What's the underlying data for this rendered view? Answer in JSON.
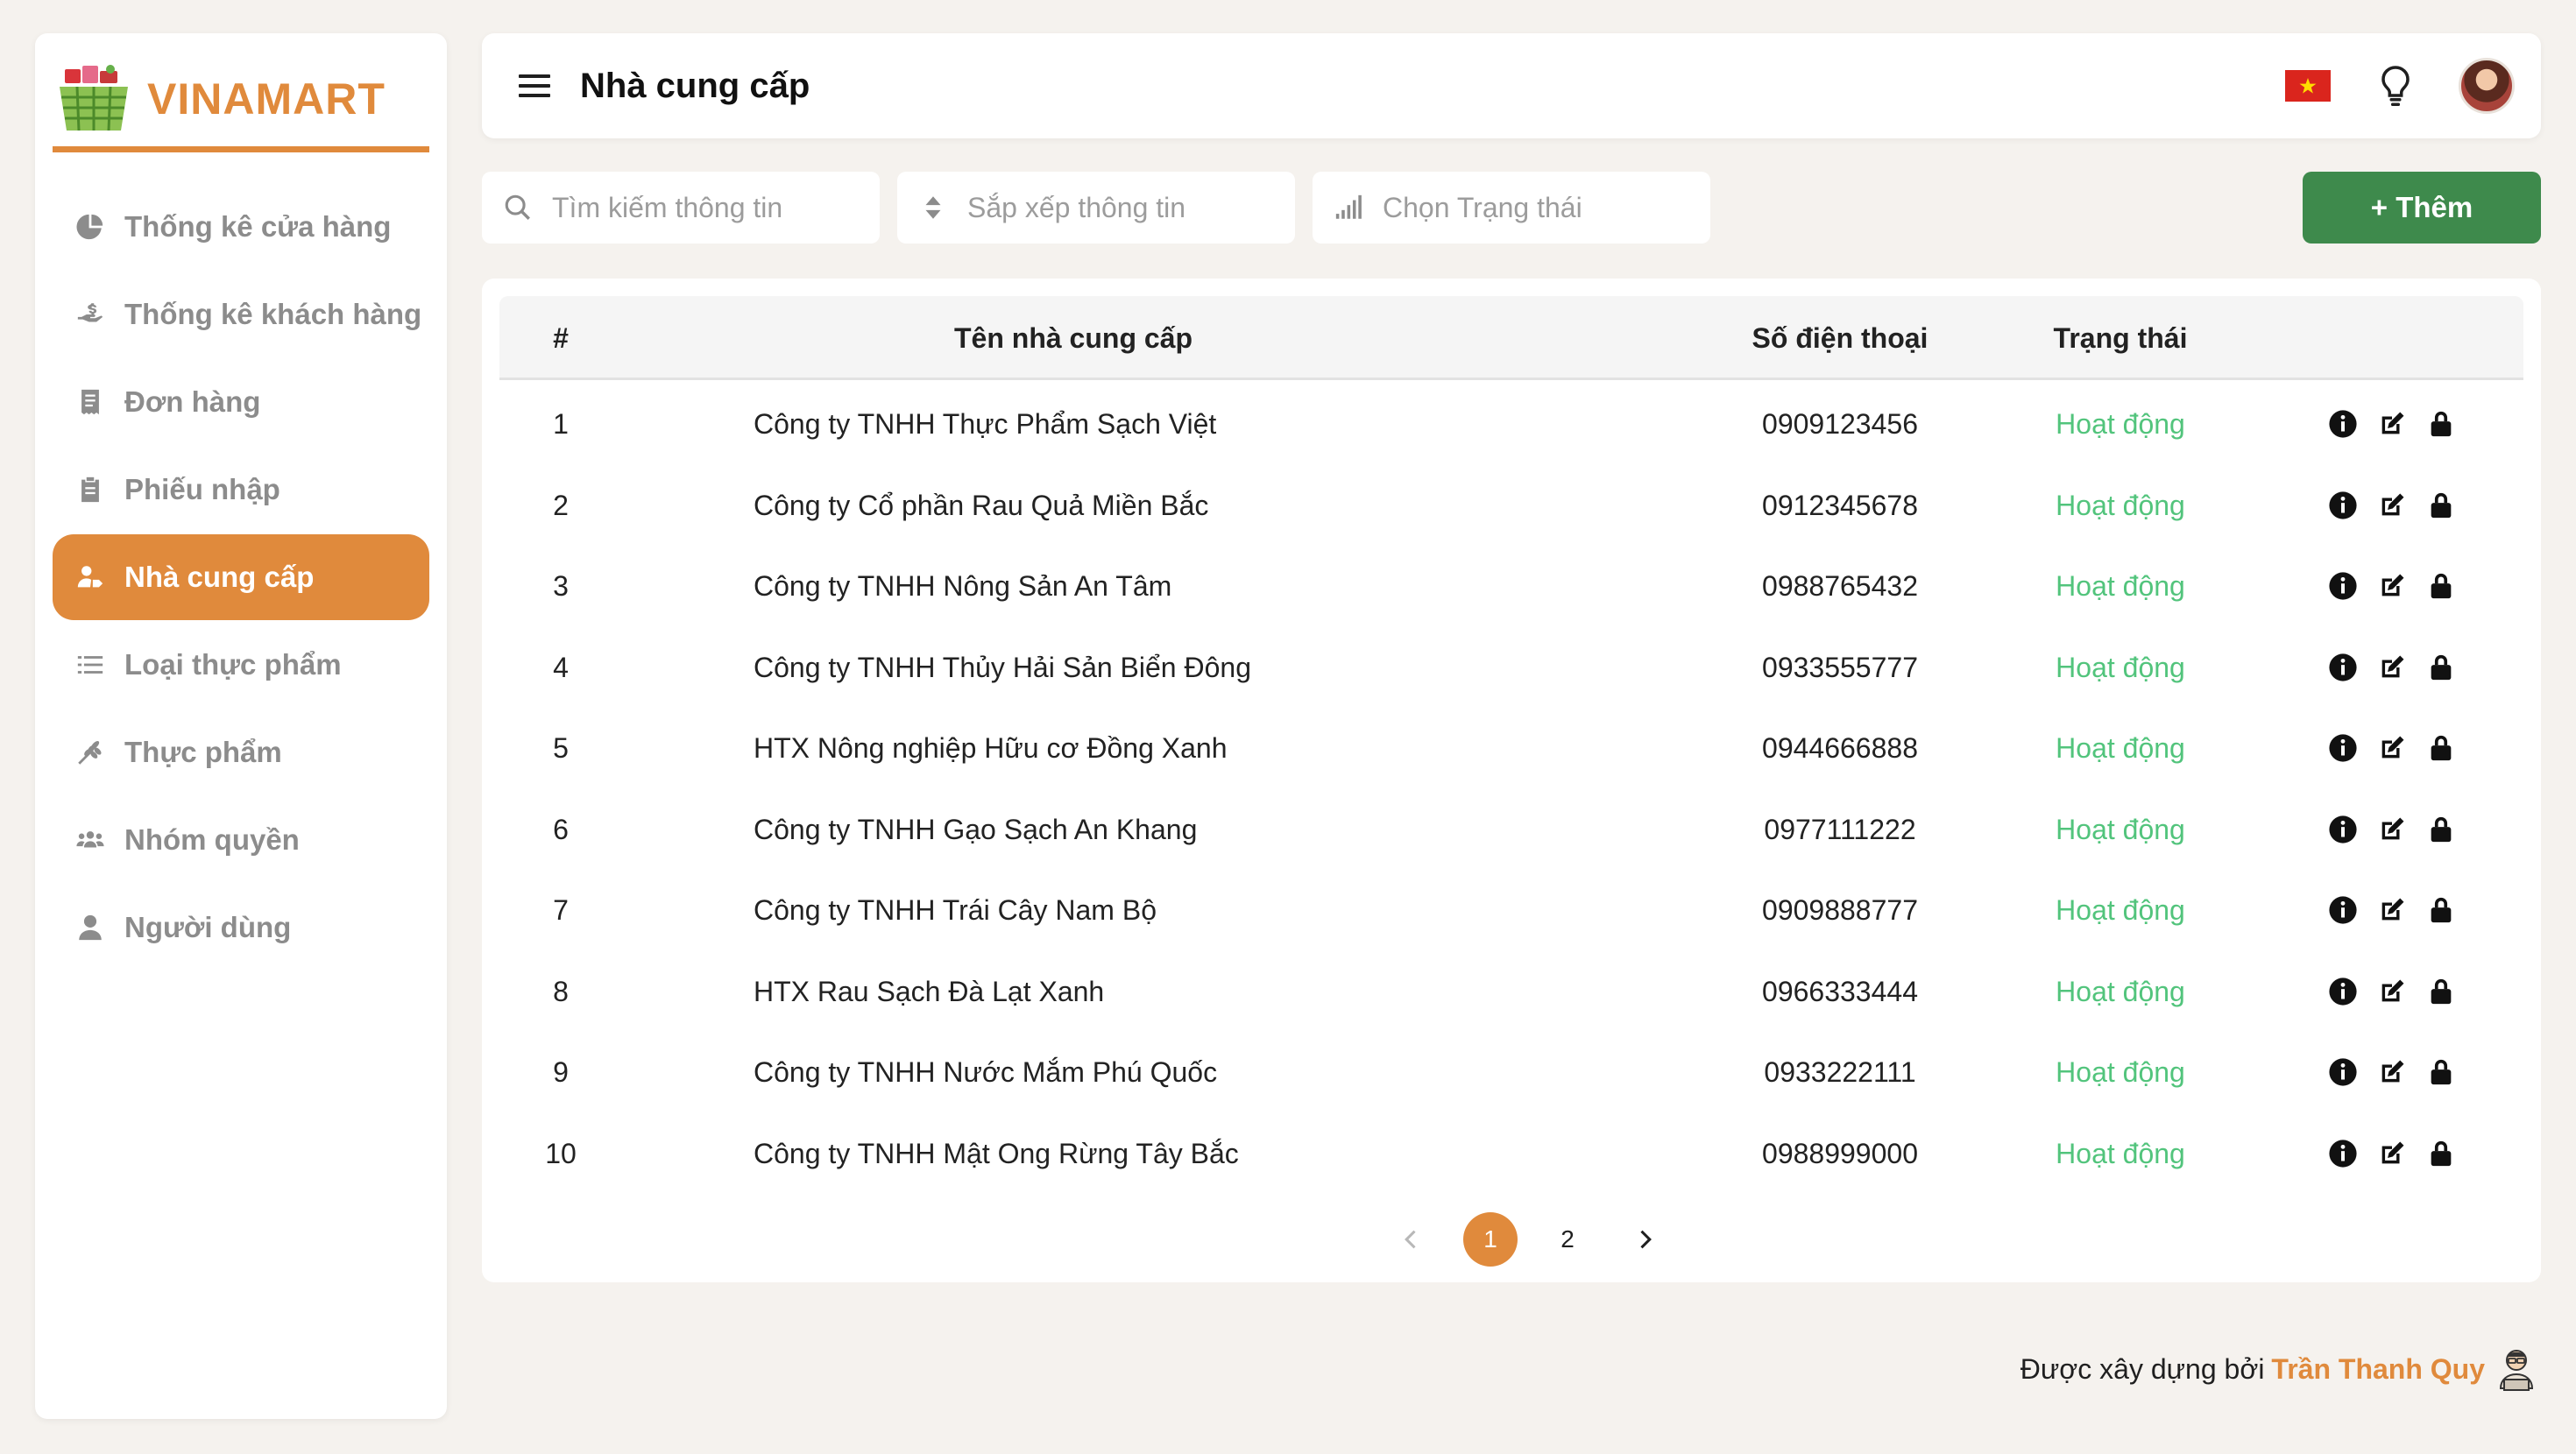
{
  "brand": {
    "name": "VINAMART"
  },
  "sidebar": {
    "items": [
      {
        "label": "Thống kê cửa hàng",
        "icon": "pie-chart-icon",
        "active": false
      },
      {
        "label": "Thống kê khách hàng",
        "icon": "hand-dollar-icon",
        "active": false
      },
      {
        "label": "Đơn hàng",
        "icon": "receipt-icon",
        "active": false
      },
      {
        "label": "Phiếu nhập",
        "icon": "clipboard-icon",
        "active": false
      },
      {
        "label": "Nhà cung cấp",
        "icon": "user-tag-icon",
        "active": true
      },
      {
        "label": "Loại thực phẩm",
        "icon": "list-icon",
        "active": false
      },
      {
        "label": "Thực phẩm",
        "icon": "wheat-icon",
        "active": false
      },
      {
        "label": "Nhóm quyền",
        "icon": "users-icon",
        "active": false
      },
      {
        "label": "Người dùng",
        "icon": "user-icon",
        "active": false
      }
    ]
  },
  "header": {
    "title": "Nhà cung cấp",
    "language": "vietnam-flag-icon"
  },
  "toolbar": {
    "search_placeholder": "Tìm kiếm thông tin",
    "sort_placeholder": "Sắp xếp thông tin",
    "status_placeholder": "Chọn Trạng thái",
    "add_label": "+ Thêm"
  },
  "table": {
    "columns": [
      "#",
      "Tên nhà cung cấp",
      "Số điện thoại",
      "Trạng thái"
    ],
    "rows": [
      {
        "idx": "1",
        "name": "Công ty TNHH Thực Phẩm Sạch Việt",
        "phone": "0909123456",
        "status": "Hoạt động"
      },
      {
        "idx": "2",
        "name": "Công ty Cổ phần Rau Quả Miền Bắc",
        "phone": "0912345678",
        "status": "Hoạt động"
      },
      {
        "idx": "3",
        "name": "Công ty TNHH Nông Sản An Tâm",
        "phone": "0988765432",
        "status": "Hoạt động"
      },
      {
        "idx": "4",
        "name": "Công ty TNHH Thủy Hải Sản Biển Đông",
        "phone": "0933555777",
        "status": "Hoạt động"
      },
      {
        "idx": "5",
        "name": "HTX Nông nghiệp Hữu cơ Đồng Xanh",
        "phone": "0944666888",
        "status": "Hoạt động"
      },
      {
        "idx": "6",
        "name": "Công ty TNHH Gạo Sạch An Khang",
        "phone": "0977111222",
        "status": "Hoạt động"
      },
      {
        "idx": "7",
        "name": "Công ty TNHH Trái Cây Nam Bộ",
        "phone": "0909888777",
        "status": "Hoạt động"
      },
      {
        "idx": "8",
        "name": "HTX Rau Sạch Đà Lạt Xanh",
        "phone": "0966333444",
        "status": "Hoạt động"
      },
      {
        "idx": "9",
        "name": "Công ty TNHH Nước Mắm Phú Quốc",
        "phone": "0933222111",
        "status": "Hoạt động"
      },
      {
        "idx": "10",
        "name": "Công ty TNHH Mật Ong Rừng Tây Bắc",
        "phone": "0988999000",
        "status": "Hoạt động"
      }
    ]
  },
  "pagination": {
    "pages": [
      "1",
      "2"
    ],
    "current": "1"
  },
  "footer": {
    "text": "Được xây dựng bởi",
    "author": "Trần Thanh Quy"
  },
  "colors": {
    "accent": "#e08a3c",
    "add_button": "#3e8a4c",
    "status_active": "#52c47c"
  }
}
